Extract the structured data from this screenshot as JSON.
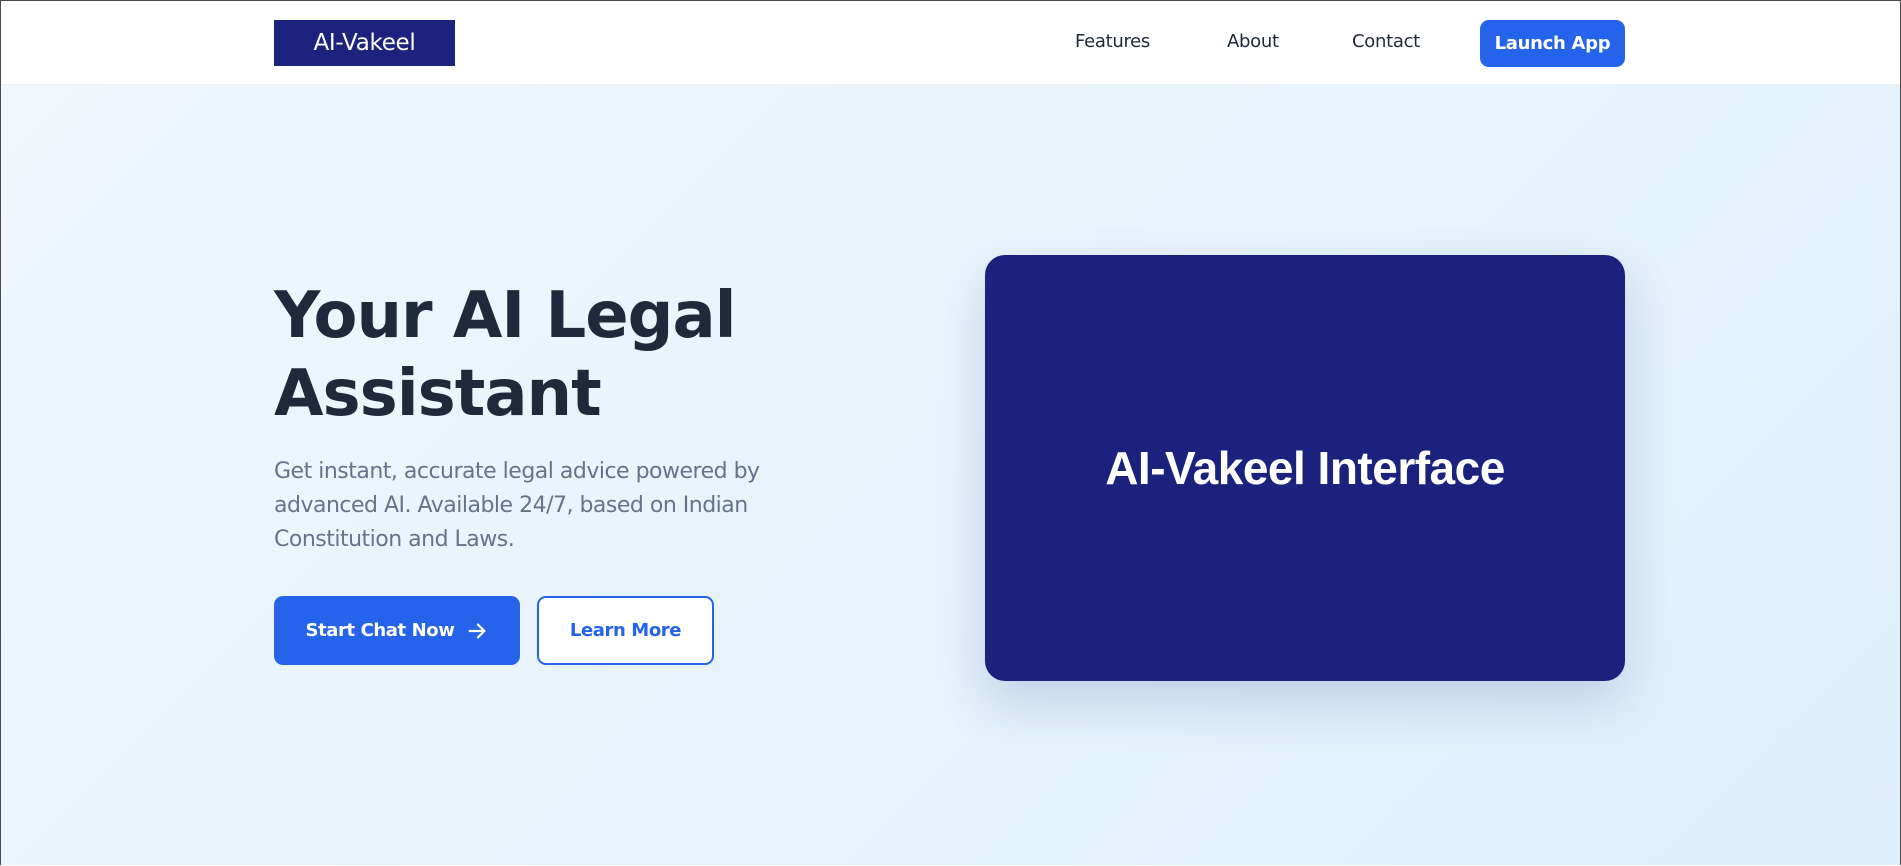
{
  "header": {
    "logo_text": "AI-Vakeel",
    "nav": {
      "features": "Features",
      "about": "About",
      "contact": "Contact"
    },
    "launch_label": "Launch App"
  },
  "hero": {
    "title_line1": "Your AI Legal",
    "title_line2": "Assistant",
    "subtitle": "Get instant, accurate legal advice powered by advanced AI. Available 24/7, based on Indian Constitution and Laws.",
    "primary_cta": "Start Chat Now",
    "primary_cta_icon": "arrow-right-icon",
    "secondary_cta": "Learn More",
    "interface_label": "AI-Vakeel Interface"
  },
  "colors": {
    "brand_navy": "#1b237e",
    "accent_blue": "#2563eb",
    "heading": "#1e293b",
    "body_text": "#64748b",
    "hero_bg": "#e7f3fc"
  }
}
